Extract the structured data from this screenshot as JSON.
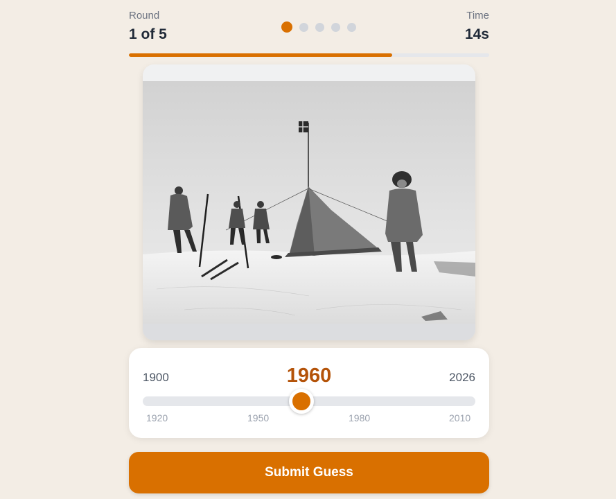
{
  "header": {
    "round_label": "Round",
    "round_value": "1 of 5",
    "time_label": "Time",
    "time_value": "14s"
  },
  "round_dots": {
    "total": 5,
    "current": 1
  },
  "timer_progress_fraction": 0.73,
  "photo": {
    "icon": "historical-photo-expedition-tent-flag"
  },
  "slider": {
    "min_label": "1900",
    "max_label": "2026",
    "value_label": "1960",
    "min": 1900,
    "max": 2026,
    "value": 1960,
    "ticks": [
      "1920",
      "1950",
      "1980",
      "2010"
    ]
  },
  "submit_label": "Submit Guess",
  "colors": {
    "accent": "#d97000",
    "accent_dark": "#b45309",
    "background": "#f3ede5",
    "inactive_dot": "#d1d5db",
    "track": "#e5e7eb"
  }
}
